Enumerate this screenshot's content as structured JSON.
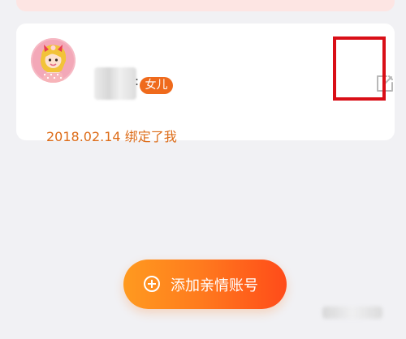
{
  "family_member": {
    "relation_label": "女儿",
    "bind_info": "2018.02.14 绑定了我",
    "colon": ":",
    "edit_icon": "edit-icon",
    "avatar_icon": "avatar"
  },
  "actions": {
    "add_label": "添加亲情账号",
    "add_icon": "plus-circle-icon"
  },
  "colors": {
    "accent_orange": "#ef6a1c",
    "highlight_red": "#d90f17",
    "background": "#f1f1f4"
  }
}
